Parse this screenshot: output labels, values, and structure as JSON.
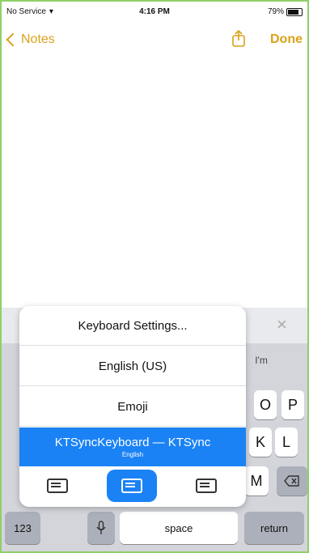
{
  "status_bar": {
    "carrier": "No Service",
    "time": "4:16 PM",
    "battery": "79%"
  },
  "nav": {
    "back_label": "Notes",
    "done_label": "Done"
  },
  "menu": {
    "items": [
      {
        "label": "Keyboard Settings..."
      },
      {
        "label": "English (US)"
      },
      {
        "label": "Emoji"
      },
      {
        "label": "KTSyncKeyboard — KTSync",
        "sublabel": "English",
        "selected": true
      }
    ],
    "layouts": [
      "left-handed-keyboard-icon",
      "full-keyboard-icon",
      "right-handed-keyboard-icon"
    ],
    "selected_layout": "full-keyboard-icon"
  },
  "keyboard": {
    "prediction_partial": "I'm",
    "keys_row1": [
      "O",
      "P"
    ],
    "keys_row2": [
      "K",
      "L"
    ],
    "keys_row3": [
      "M"
    ],
    "numbers_label": "123",
    "space_label": "space",
    "return_label": "return"
  },
  "colors": {
    "accent": "#d9a21b",
    "selected": "#1a82f5"
  }
}
